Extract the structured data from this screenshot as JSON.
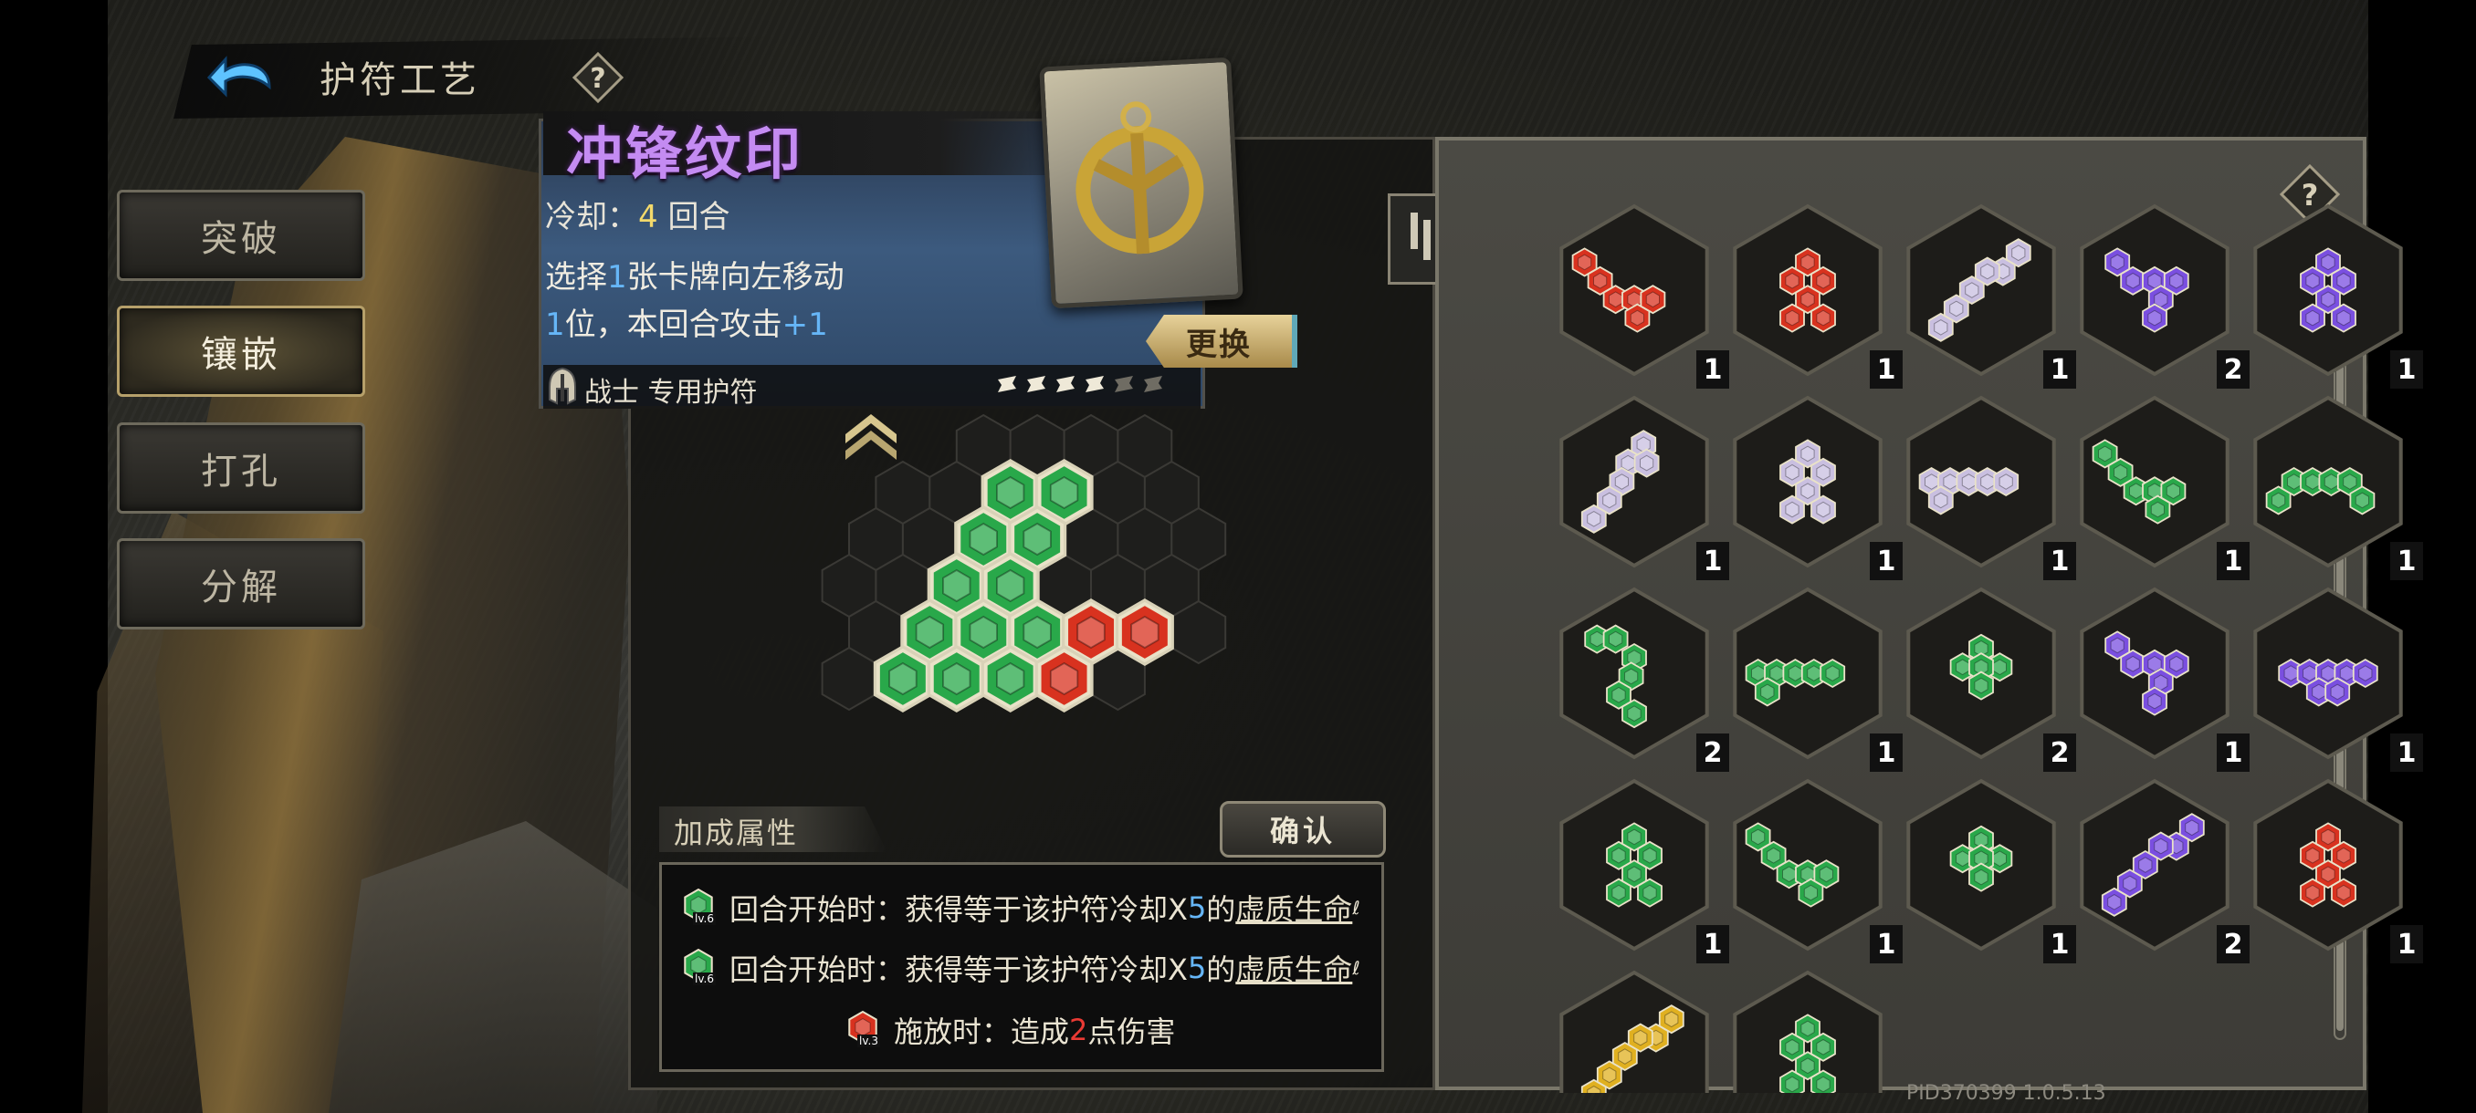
{
  "header": {
    "title": "护符工艺",
    "back_icon": "back-arrow-icon",
    "help_icon": "help-question-icon"
  },
  "menu": [
    {
      "label": "突破",
      "active": false
    },
    {
      "label": "镶嵌",
      "active": true
    },
    {
      "label": "打孔",
      "active": false
    },
    {
      "label": "分解",
      "active": false
    }
  ],
  "amulet": {
    "name": "冲锋纹印",
    "cooldown_label": "冷却：",
    "cooldown_value": "4",
    "cooldown_unit": " 回合",
    "desc_line1_a": "选择",
    "desc_line1_num": "1",
    "desc_line1_b": "张卡牌向左移动",
    "desc_line2_num": "1",
    "desc_line2_a": "位，本回合攻击",
    "desc_line2_bonus": "+1",
    "swap_label": "更换",
    "class_label": "战士 专用护符",
    "pips_filled": 4,
    "pips_total": 6
  },
  "colors": {
    "green": "#29a84a",
    "red": "#d8321f",
    "purple": "#7a4fe0",
    "white": "#c9bfe0",
    "yellow": "#e0b020",
    "accent_purple": "#c48bf2",
    "highlight_blue": "#66b6f7"
  },
  "board": {
    "gems": [
      {
        "col": 3,
        "row": 0,
        "color": "green"
      },
      {
        "col": 4,
        "row": 0,
        "color": "green"
      },
      {
        "col": 2,
        "row": 1,
        "color": "green"
      },
      {
        "col": 3,
        "row": 1,
        "color": "green"
      },
      {
        "col": 2,
        "row": 2,
        "color": "green"
      },
      {
        "col": 3,
        "row": 2,
        "color": "green"
      },
      {
        "col": 1,
        "row": 3,
        "color": "green"
      },
      {
        "col": 2,
        "row": 3,
        "color": "green"
      },
      {
        "col": 3,
        "row": 3,
        "color": "green"
      },
      {
        "col": 4,
        "row": 3,
        "color": "red"
      },
      {
        "col": 5,
        "row": 3,
        "color": "red"
      },
      {
        "col": 1,
        "row": 4,
        "color": "green"
      },
      {
        "col": 2,
        "row": 4,
        "color": "green"
      },
      {
        "col": 3,
        "row": 4,
        "color": "green"
      },
      {
        "col": 4,
        "row": 4,
        "color": "red"
      }
    ]
  },
  "bonus": {
    "title": "加成属性",
    "confirm_label": "确认",
    "rows": [
      {
        "gem": "green",
        "level": "lv.6",
        "text_a": "回合开始时：获得等于该护符冷却X",
        "num": "5",
        "text_b": "的",
        "link": "虚质生命",
        "suffix": "ℓ"
      },
      {
        "gem": "green",
        "level": "lv.6",
        "text_a": "回合开始时：获得等于该护符冷却X",
        "num": "5",
        "text_b": "的",
        "link": "虚质生命",
        "suffix": "ℓ"
      },
      {
        "gem": "red",
        "level": "lv.3",
        "text_a": "施放时：造成",
        "num": "2",
        "text_b": "点伤害",
        "link": "",
        "suffix": ""
      }
    ]
  },
  "inventory": [
    {
      "color": "red",
      "count": "1",
      "shape": "zig"
    },
    {
      "color": "red",
      "count": "1",
      "shape": "tri"
    },
    {
      "color": "white",
      "count": "1",
      "shape": "diag"
    },
    {
      "color": "purple",
      "count": "2",
      "shape": "v"
    },
    {
      "color": "purple",
      "count": "1",
      "shape": "tri"
    },
    {
      "color": "white",
      "count": "1",
      "shape": "diagL"
    },
    {
      "color": "white",
      "count": "1",
      "shape": "tri"
    },
    {
      "color": "white",
      "count": "1",
      "shape": "line"
    },
    {
      "color": "green",
      "count": "1",
      "shape": "zig"
    },
    {
      "color": "green",
      "count": "1",
      "shape": "wave"
    },
    {
      "color": "green",
      "count": "2",
      "shape": "s"
    },
    {
      "color": "green",
      "count": "1",
      "shape": "line"
    },
    {
      "color": "green",
      "count": "2",
      "shape": "diamond"
    },
    {
      "color": "purple",
      "count": "1",
      "shape": "v"
    },
    {
      "color": "purple",
      "count": "1",
      "shape": "t"
    },
    {
      "color": "green",
      "count": "1",
      "shape": "tri"
    },
    {
      "color": "green",
      "count": "1",
      "shape": "zig"
    },
    {
      "color": "green",
      "count": "1",
      "shape": "diamond"
    },
    {
      "color": "purple",
      "count": "2",
      "shape": "diag"
    },
    {
      "color": "red",
      "count": "1",
      "shape": "tri"
    },
    {
      "color": "yellow",
      "count": "",
      "shape": "diag"
    },
    {
      "color": "green",
      "count": "",
      "shape": "tri"
    }
  ],
  "footer": {
    "pid": "PID370399 1.0.5.13"
  }
}
